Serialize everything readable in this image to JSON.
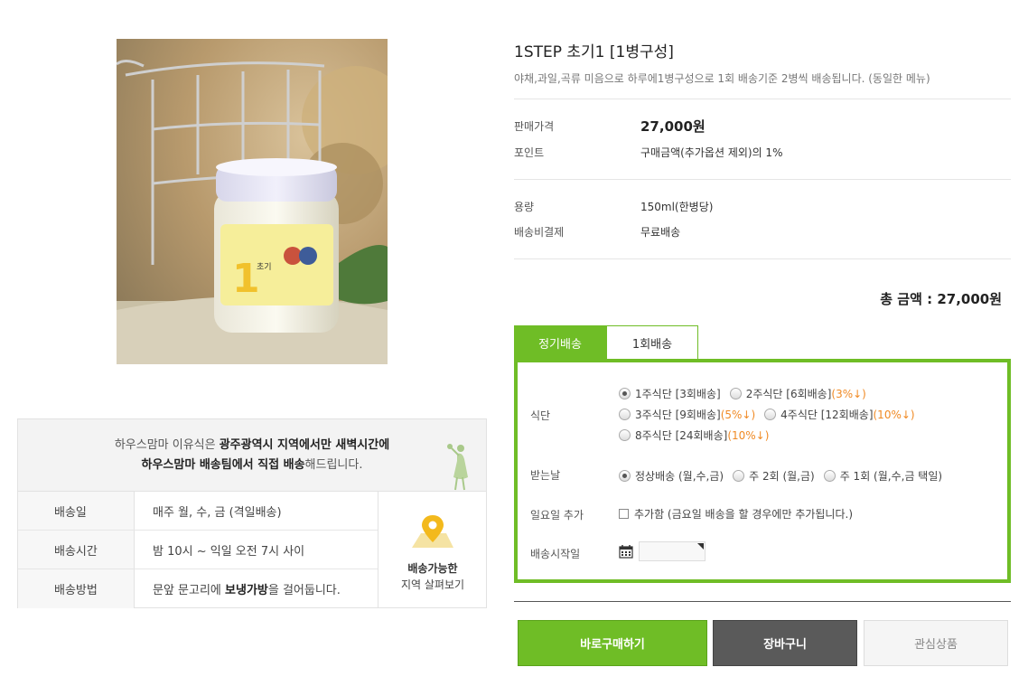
{
  "product": {
    "title": "1STEP 초기1 [1병구성]",
    "subtitle": "야채,과일,곡류 미음으로 하루에1병구성으로 1회 배송기준 2병씩 배송됩니다. (동일한 메뉴)",
    "price_label": "판매가격",
    "price_value": "27,000원",
    "point_label": "포인트",
    "point_value": "구매금액(추가옵션 제외)의 1%",
    "volume_label": "용량",
    "volume_value": "150ml(한병당)",
    "shipping_label": "배송비결제",
    "shipping_value": "무료배송",
    "total": "총 금액 : 27,000원",
    "jar_label": "초기"
  },
  "tabs": [
    "정기배송",
    "1회배송"
  ],
  "options": {
    "diet_label": "식단",
    "diet_options": [
      {
        "text": "1주식단 [3회배송]",
        "discount": "",
        "selected": true
      },
      {
        "text": "2주식단 [6회배송]",
        "discount": "(3%↓)",
        "selected": false
      },
      {
        "text": "3주식단 [9회배송]",
        "discount": "(5%↓)",
        "selected": false
      },
      {
        "text": "4주식단 [12회배송]",
        "discount": "(10%↓)",
        "selected": false
      },
      {
        "text": "8주식단 [24회배송]",
        "discount": "(10%↓)",
        "selected": false
      }
    ],
    "receive_label": "받는날",
    "receive_options": [
      {
        "text": "정상배송 (월,수,금)",
        "selected": true
      },
      {
        "text": "주 2회 (월,금)",
        "selected": false
      },
      {
        "text": "주 1회 (월,수,금 택일)",
        "selected": false
      }
    ],
    "sunday_label": "일요일 추가",
    "sunday_text": "추가함 (금요일 배송을 할 경우에만 추가됩니다.)",
    "start_label": "배송시작일"
  },
  "buttons": {
    "buy": "바로구매하기",
    "cart": "장바구니",
    "wish": "관심상품"
  },
  "delivery": {
    "intro_prefix": "하우스맘마 이유식은 ",
    "intro_bold1": "광주광역시 지역에서만 새벽시간에",
    "intro_bold2": "하우스맘마 배송팀에서 직접 배송",
    "intro_suffix": "해드립니다.",
    "rows": [
      {
        "label": "배송일",
        "value": "매주 월, 수, 금 (격일배송)",
        "bold": ""
      },
      {
        "label": "배송시간",
        "value": "밤 10시 ~ 익일 오전 7시 사이",
        "bold": ""
      },
      {
        "label": "배송방법",
        "value_prefix": "문앞 문고리에 ",
        "bold": "보냉가방",
        "value_suffix": "을 걸어둡니다."
      }
    ],
    "map_line1": "배송가능한",
    "map_line2": "지역 살펴보기"
  },
  "colors": {
    "accent_green": "#6fbd26",
    "discount_orange": "#f08a24",
    "cart_gray": "#5a5a5a"
  }
}
